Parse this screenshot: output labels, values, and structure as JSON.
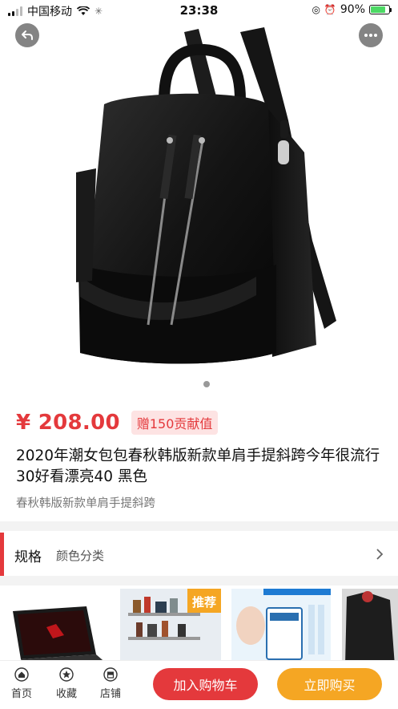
{
  "status_bar": {
    "carrier": "中国移动",
    "time": "23:38",
    "battery_percent": "90%",
    "battery_level": 0.9
  },
  "product": {
    "price": "¥ 208.00",
    "badge": "赠150贡献值",
    "title": "2020年潮女包包春秋韩版新款单肩手提斜跨今年很流行30好看漂亮40 黑色",
    "subtitle": "春秋韩版新款单肩手提斜跨",
    "image_icon": "black-leather-backpack"
  },
  "spec": {
    "label": "规格",
    "value": "颜色分类"
  },
  "recommendations": [
    {
      "icon": "laptop-product-image"
    },
    {
      "icon": "shelf-product-image",
      "tag": "推荐"
    },
    {
      "icon": "face-mask-product-image"
    },
    {
      "icon": "clothing-product-image"
    }
  ],
  "bottom_nav": {
    "items": [
      {
        "label": "首页",
        "icon": "home-icon"
      },
      {
        "label": "收藏",
        "icon": "star-icon"
      },
      {
        "label": "店铺",
        "icon": "store-icon"
      }
    ],
    "add_to_cart": "加入购物车",
    "buy_now": "立即购买"
  },
  "colors": {
    "accent_red": "#e4393c",
    "accent_orange": "#f5a623"
  }
}
